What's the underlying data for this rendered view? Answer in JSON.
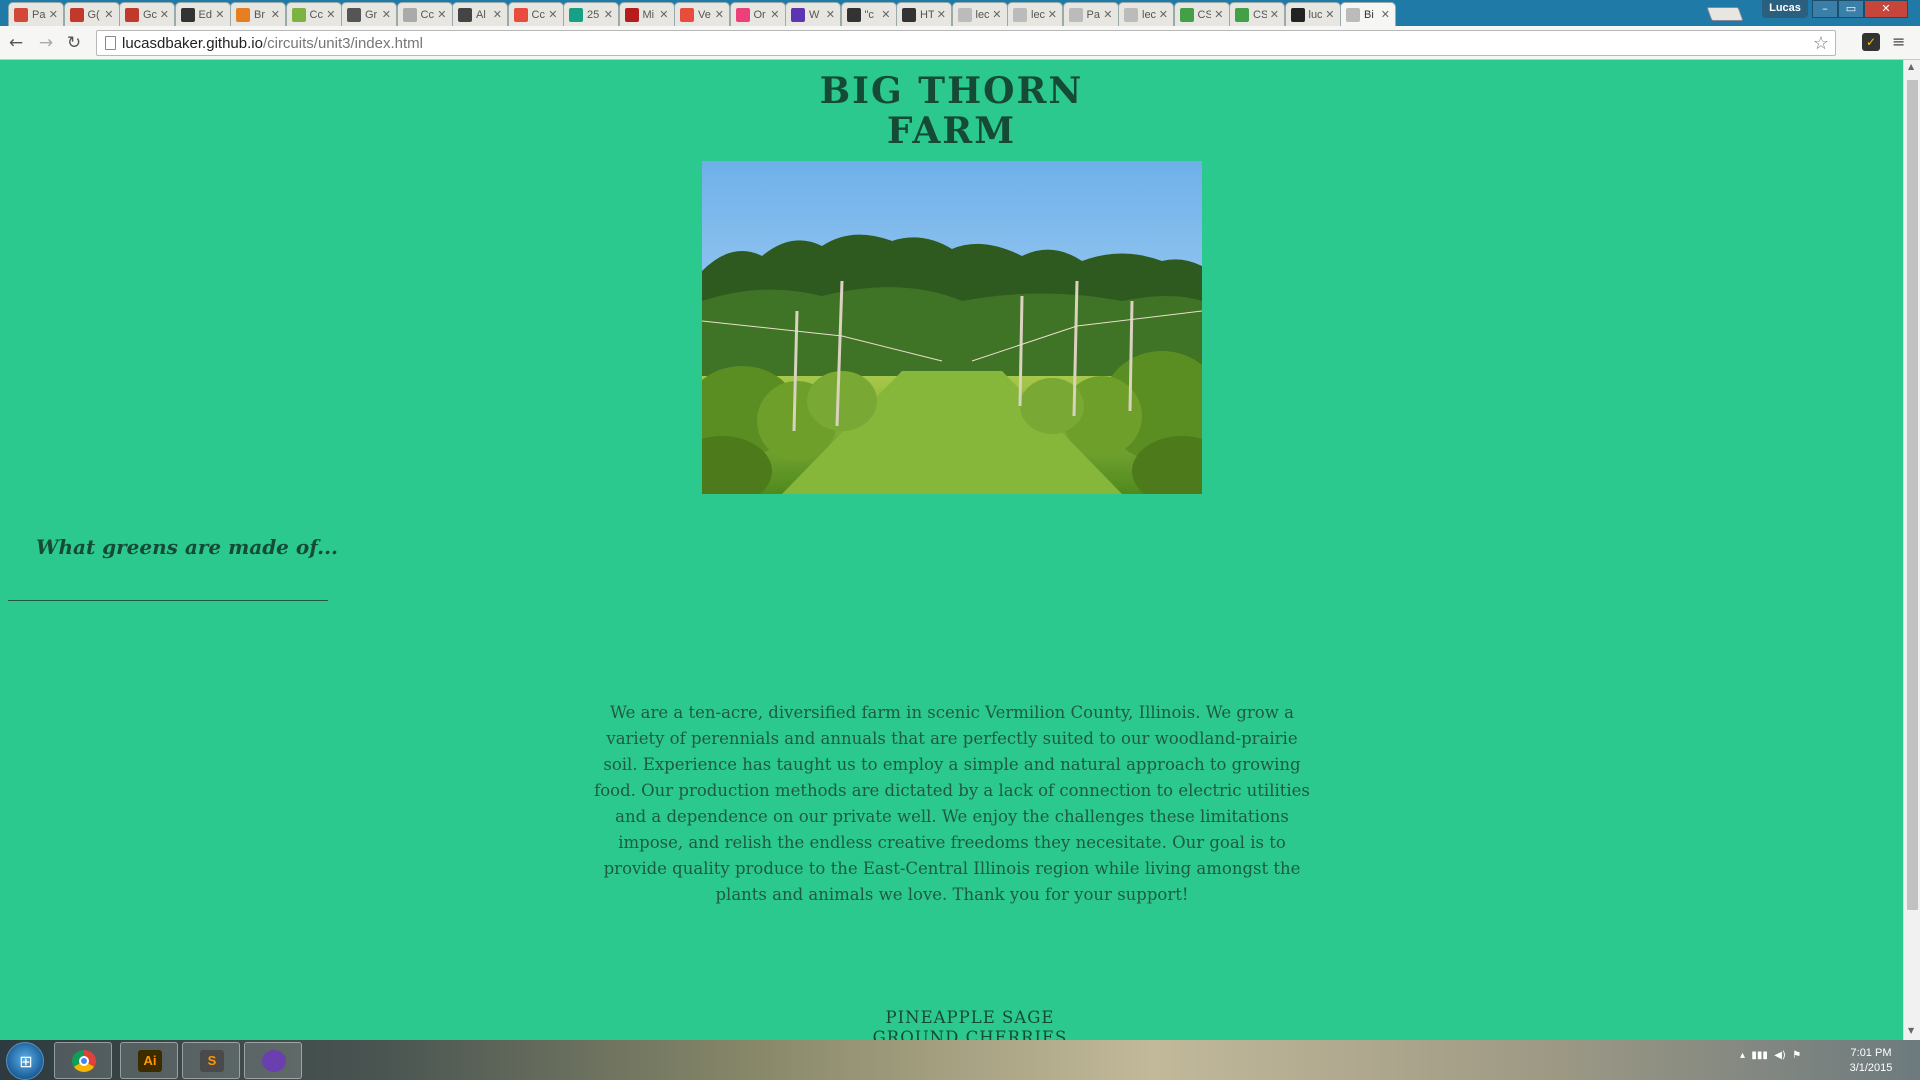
{
  "browser": {
    "tabs": [
      {
        "label": "Pa",
        "color": "#d34836"
      },
      {
        "label": "G(",
        "color": "#c0392b"
      },
      {
        "label": "Gc",
        "color": "#c0392b"
      },
      {
        "label": "Ed",
        "color": "#333333"
      },
      {
        "label": "Br",
        "color": "#e67e22"
      },
      {
        "label": "Cc",
        "color": "#7cb342"
      },
      {
        "label": "Gr",
        "color": "#555555"
      },
      {
        "label": "Cc",
        "color": "#aaaaaa"
      },
      {
        "label": "Al",
        "color": "#444444"
      },
      {
        "label": "Cc",
        "color": "#e74c3c"
      },
      {
        "label": "25",
        "color": "#16a085"
      },
      {
        "label": "Mi",
        "color": "#b71c1c"
      },
      {
        "label": "Ve",
        "color": "#e74c3c"
      },
      {
        "label": "Or",
        "color": "#ec407a"
      },
      {
        "label": "W",
        "color": "#5e35b1"
      },
      {
        "label": "\"c",
        "color": "#333333"
      },
      {
        "label": "HT",
        "color": "#333333"
      },
      {
        "label": "lec",
        "color": "#bbbbbb"
      },
      {
        "label": "lec",
        "color": "#bbbbbb"
      },
      {
        "label": "Pa",
        "color": "#bbbbbb"
      },
      {
        "label": "lec",
        "color": "#bbbbbb"
      },
      {
        "label": "CS",
        "color": "#43a047"
      },
      {
        "label": "CS",
        "color": "#43a047"
      },
      {
        "label": "luc",
        "color": "#222222"
      },
      {
        "label": "Bi",
        "color": "#bbbbbb"
      }
    ],
    "active_tab": 24,
    "profile_name": "Lucas",
    "url_host": "lucasdbaker.github.io",
    "url_path": "/circuits/unit3/index.html"
  },
  "page": {
    "title_line1": "BIG THORN",
    "title_line2": "FARM",
    "hero_alt": "Rows of young fruit trees in a grassy field",
    "side_heading": "What greens are made of...",
    "about": "We are a ten-acre, diversified farm in scenic Vermilion County, Illinois. We grow a variety of perennials and annuals that are perfectly suited to our woodland-prairie soil. Experience has taught us to employ a simple and natural approach to growing food. Our production methods are dictated by a lack of connection to electric utilities and a dependence on our private well. We enjoy the challenges these limitations impose, and relish the endless creative freedoms they necesitate. Our goal is to provide quality produce to the East-Central Illinois region while living amongst the plants and animals we love. Thank you for your support!",
    "crops": [
      "PINEAPPLE SAGE",
      "GROUND CHERRIES"
    ]
  },
  "taskbar": {
    "apps": [
      {
        "name": "Chrome",
        "glyph": "",
        "bg": "#ffffff",
        "fg": "#ffffff"
      },
      {
        "name": "Illustrator",
        "glyph": "Ai",
        "bg": "#3d2b00",
        "fg": "#ff9a00"
      },
      {
        "name": "Sublime Text",
        "glyph": "S",
        "bg": "#4a4a4a",
        "fg": "#ff9800"
      },
      {
        "name": "GitHub",
        "glyph": "",
        "bg": "#6a3fb0",
        "fg": "#ffffff"
      }
    ],
    "time": "7:01 PM",
    "date": "3/1/2015"
  }
}
